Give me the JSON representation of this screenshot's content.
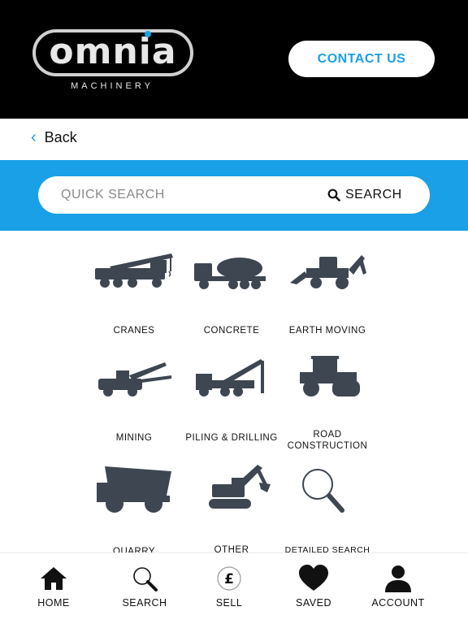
{
  "header": {
    "logo_text": "omnia",
    "logo_subtext": "MACHINERY",
    "contact_label": "CONTACT US",
    "brand_color": "#1aa0e6"
  },
  "nav": {
    "back_label": "Back"
  },
  "search": {
    "placeholder": "QUICK SEARCH",
    "button_label": "SEARCH"
  },
  "categories": [
    {
      "label": "CRANES",
      "icon": "crane-icon"
    },
    {
      "label": "CONCRETE",
      "icon": "concrete-mixer-icon"
    },
    {
      "label": "EARTH MOVING",
      "icon": "backhoe-loader-icon"
    },
    {
      "label": "MINING",
      "icon": "mining-drill-rig-icon"
    },
    {
      "label": "PILING & DRILLING",
      "icon": "piling-rig-icon"
    },
    {
      "label": "ROAD CONSTRUCTION",
      "icon": "road-roller-icon"
    },
    {
      "label": "QUARRY",
      "icon": "dump-truck-icon"
    },
    {
      "label": "OTHER",
      "icon": "excavator-icon"
    },
    {
      "label": "DETAILED SEARCH",
      "icon": "magnifier-icon"
    }
  ],
  "bottom_nav": [
    {
      "label": "HOME",
      "icon": "home-icon"
    },
    {
      "label": "SEARCH",
      "icon": "search-icon"
    },
    {
      "label": "SELL",
      "icon": "pound-icon"
    },
    {
      "label": "SAVED",
      "icon": "heart-icon"
    },
    {
      "label": "ACCOUNT",
      "icon": "user-icon"
    }
  ]
}
